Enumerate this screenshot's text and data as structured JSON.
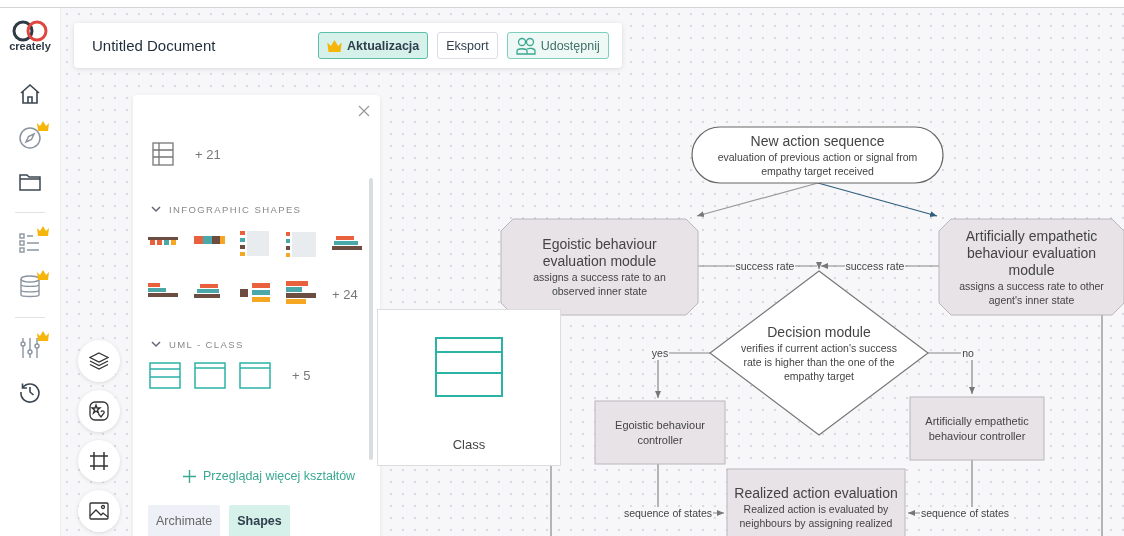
{
  "logo": {
    "text": "creately"
  },
  "nav_groups": [
    {
      "items": [
        {
          "premium": false
        },
        {
          "premium": true
        },
        {
          "premium": false
        }
      ]
    },
    {
      "items": [
        {
          "premium": true
        },
        {
          "premium": true
        }
      ]
    },
    {
      "items": [
        {
          "premium": true
        },
        {
          "premium": false
        }
      ]
    }
  ],
  "header": {
    "title": "Untitled Document",
    "buttons": [
      {
        "kind": "upgrade",
        "label": "Aktualizacja"
      },
      {
        "kind": "plain",
        "label": "Eksport"
      },
      {
        "kind": "share",
        "label": "Udostępnij"
      }
    ]
  },
  "shapes_panel": {
    "top_row": {
      "more": "+ 21"
    },
    "sections": [
      {
        "kind": "infographic",
        "title": "INFOGRAPHIC SHAPES",
        "expanded": true,
        "more": "+ 24"
      },
      {
        "kind": "uml-class",
        "title": "UML - CLASS",
        "expanded": true,
        "more": "+ 5"
      }
    ],
    "browse_link": "Przeglądaj więcej kształtów",
    "tabs": [
      {
        "label": "Archimate",
        "selected": false
      },
      {
        "label": "Shapes",
        "selected": true
      }
    ]
  },
  "preview": {
    "label": "Class"
  },
  "diagram": {
    "nodes": [
      {
        "kind": "terminal",
        "title": "New action sequence",
        "description": "evaluation of previous action or signal from empathy target received"
      },
      {
        "kind": "module",
        "title": "Egoistic behaviour evaluation module",
        "description": "assigns a success rate to an observed inner state"
      },
      {
        "kind": "module",
        "title": "Artificially empathetic behaviour evaluation module",
        "description": "assigns a success rate to other agent's inner state"
      },
      {
        "kind": "decision",
        "title": "Decision module",
        "description": "verifies if current action's success rate is higher than the one of the empathy target"
      },
      {
        "kind": "process",
        "title": "Egoistic behaviour controller"
      },
      {
        "kind": "process",
        "title": "Artificially empathetic behaviour controller"
      },
      {
        "kind": "process",
        "title": "Realized action evaluation",
        "description": "Realized action is evaluated by neighbours by assigning realized"
      }
    ],
    "connectors": [
      {
        "label": "success rate"
      },
      {
        "label": "success rate"
      },
      {
        "label": "yes"
      },
      {
        "label": "no"
      },
      {
        "label": "sequence of states"
      },
      {
        "label": "sequence of states"
      }
    ]
  }
}
